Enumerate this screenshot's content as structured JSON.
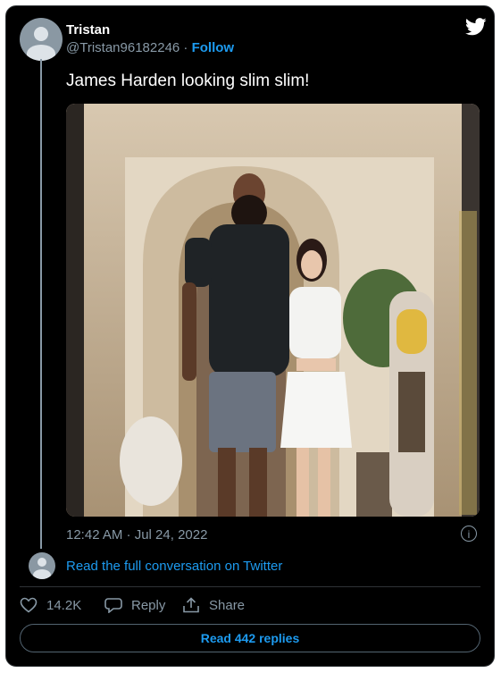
{
  "tweet": {
    "author_name": "Tristan",
    "author_handle": "@Tristan96182246",
    "separator": " · ",
    "follow_label": "Follow",
    "text": "James Harden looking slim slim!",
    "timestamp": "12:42 AM · Jul 24, 2022",
    "info_icon": "i"
  },
  "conversation": {
    "read_full_label": "Read the full conversation on Twitter"
  },
  "actions": {
    "likes_count": "14.2K",
    "reply_label": "Reply",
    "share_label": "Share"
  },
  "replies_button": {
    "label": "Read 442 replies"
  },
  "colors": {
    "background": "#000000",
    "accent": "#1d9bf0",
    "muted": "#8899a6"
  },
  "icons": [
    "twitter-bird-icon",
    "heart-icon",
    "reply-icon",
    "share-icon",
    "info-icon"
  ]
}
